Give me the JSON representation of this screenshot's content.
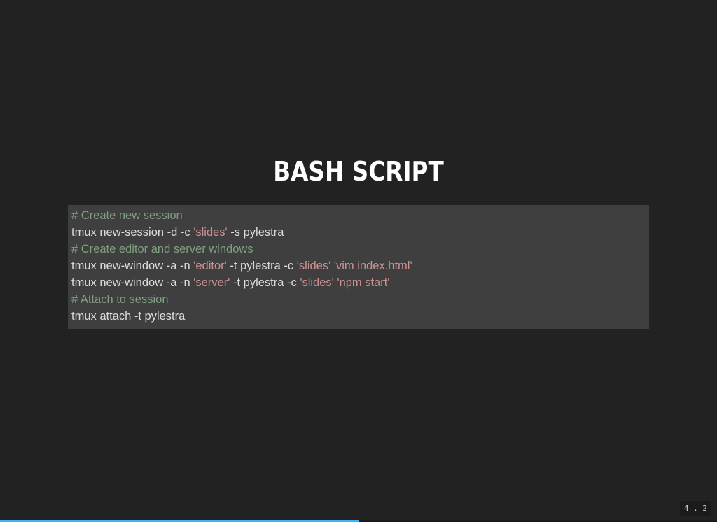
{
  "slide": {
    "title": "BASH SCRIPT",
    "code_lines": [
      [
        {
          "type": "comment",
          "text": "# Create new session"
        }
      ],
      [
        {
          "type": "plain",
          "text": "tmux new-session -d -c "
        },
        {
          "type": "str",
          "text": "'slides'"
        },
        {
          "type": "plain",
          "text": " -s pylestra"
        }
      ],
      [
        {
          "type": "comment",
          "text": "# Create editor and server windows"
        }
      ],
      [
        {
          "type": "plain",
          "text": "tmux new-window -a -n "
        },
        {
          "type": "str",
          "text": "'editor'"
        },
        {
          "type": "plain",
          "text": " -t pylestra -c "
        },
        {
          "type": "str",
          "text": "'slides'"
        },
        {
          "type": "plain",
          "text": " "
        },
        {
          "type": "str",
          "text": "'vim index.html'"
        }
      ],
      [
        {
          "type": "plain",
          "text": "tmux new-window -a -n "
        },
        {
          "type": "str",
          "text": "'server'"
        },
        {
          "type": "plain",
          "text": " -t pylestra -c "
        },
        {
          "type": "str",
          "text": "'slides'"
        },
        {
          "type": "plain",
          "text": " "
        },
        {
          "type": "str",
          "text": "'npm start'"
        }
      ],
      [
        {
          "type": "comment",
          "text": "# Attach to session"
        }
      ],
      [
        {
          "type": "plain",
          "text": "tmux attach -t pylestra"
        }
      ]
    ],
    "slide_number": "4 . 2",
    "progress": 0.5
  },
  "colors": {
    "background": "#222222",
    "code_background": "#3f3f3f",
    "comment": "#7f9f7f",
    "string": "#cc9393",
    "plain": "#dcdcdc",
    "progress": "#42affa"
  }
}
